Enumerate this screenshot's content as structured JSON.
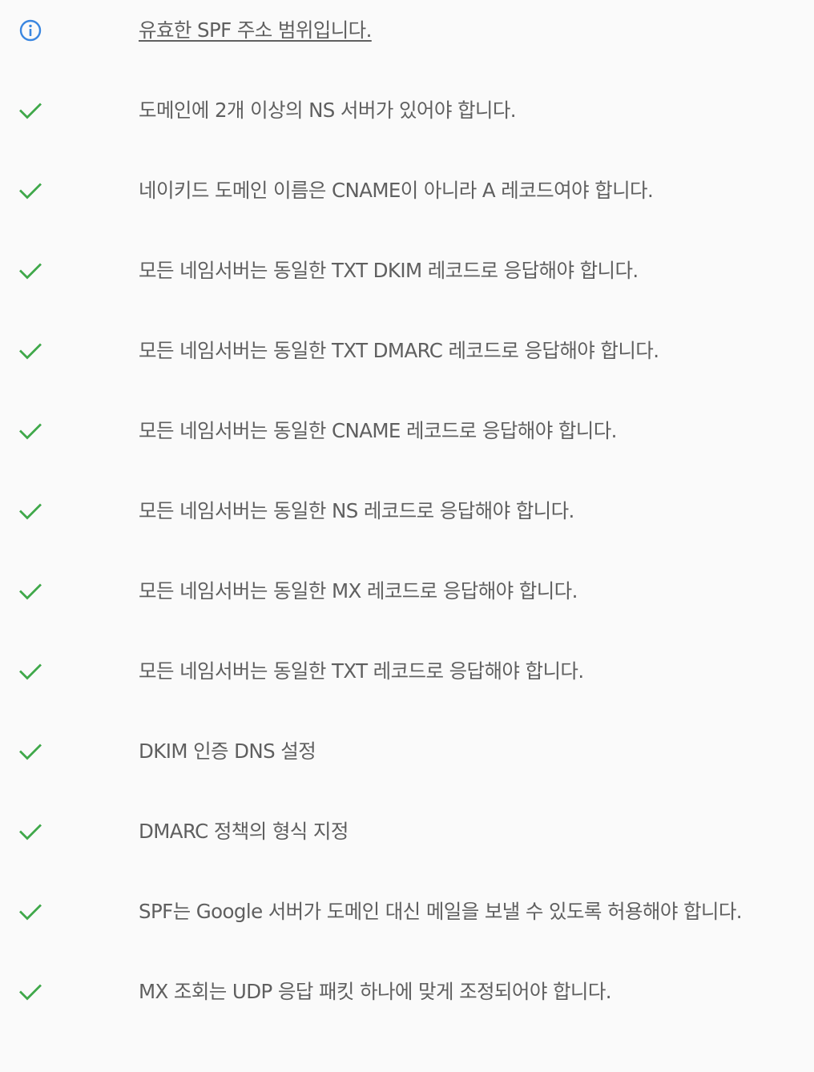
{
  "colors": {
    "text": "#5f5f5f",
    "check": "#3fa84a",
    "info": "#3a86e0",
    "background": "#fafafa"
  },
  "checks": [
    {
      "icon": "info-icon",
      "text": "유효한 SPF 주소 범위입니다.",
      "link": true
    },
    {
      "icon": "check-icon",
      "text": "도메인에 2개 이상의 NS 서버가 있어야 합니다."
    },
    {
      "icon": "check-icon",
      "text": "네이키드 도메인 이름은 CNAME이 아니라 A 레코드여야 합니다."
    },
    {
      "icon": "check-icon",
      "text": "모든 네임서버는 동일한 TXT DKIM 레코드로 응답해야 합니다."
    },
    {
      "icon": "check-icon",
      "text": "모든 네임서버는 동일한 TXT DMARC 레코드로 응답해야 합니다."
    },
    {
      "icon": "check-icon",
      "text": "모든 네임서버는 동일한 CNAME 레코드로 응답해야 합니다."
    },
    {
      "icon": "check-icon",
      "text": "모든 네임서버는 동일한 NS 레코드로 응답해야 합니다."
    },
    {
      "icon": "check-icon",
      "text": "모든 네임서버는 동일한 MX 레코드로 응답해야 합니다."
    },
    {
      "icon": "check-icon",
      "text": "모든 네임서버는 동일한 TXT 레코드로 응답해야 합니다."
    },
    {
      "icon": "check-icon",
      "text": "DKIM 인증 DNS 설정"
    },
    {
      "icon": "check-icon",
      "text": "DMARC 정책의 형식 지정"
    },
    {
      "icon": "check-icon",
      "text": "SPF는 Google 서버가 도메인 대신 메일을 보낼 수 있도록 허용해야 합니다."
    },
    {
      "icon": "check-icon",
      "text": "MX 조회는 UDP 응답 패킷 하나에 맞게 조정되어야 합니다."
    }
  ]
}
